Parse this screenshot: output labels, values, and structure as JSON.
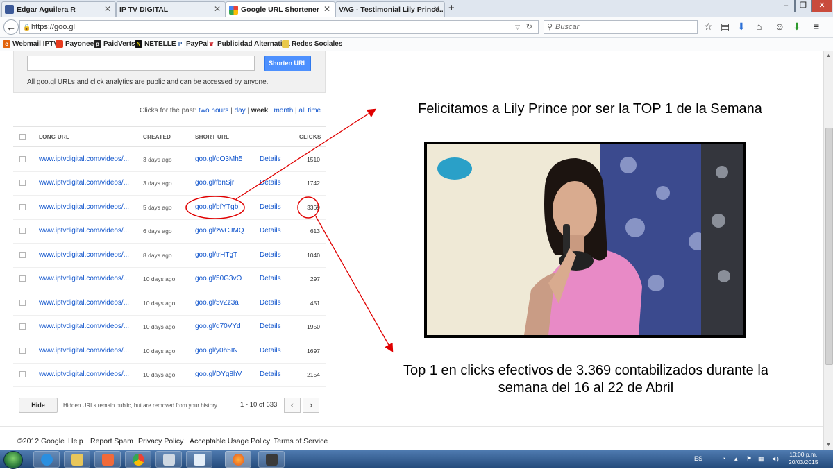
{
  "browser": {
    "tabs": [
      {
        "title": "Edgar Aguilera R"
      },
      {
        "title": "IP TV DIGITAL"
      },
      {
        "title": "Google URL Shortener"
      },
      {
        "title": "VAG - Testimonial Lily Prince..."
      }
    ],
    "url": "https://goo.gl",
    "search_placeholder": "Buscar"
  },
  "bookmarks": [
    "Webmail IPTV",
    "Payoneer",
    "PaidVerts",
    "NETELLER",
    "PayPal",
    "Publicidad Alternativa",
    "Redes Sociales"
  ],
  "shortener": {
    "button_label": "Shorten URL",
    "note": "All goo.gl URLs and click analytics are public and can be accessed by anyone."
  },
  "clicks_filter": {
    "prefix": "Clicks for the past:",
    "options": [
      "two hours",
      "day",
      "week",
      "month",
      "all time"
    ],
    "selected": "week"
  },
  "table": {
    "headers": [
      "LONG URL",
      "CREATED",
      "SHORT URL",
      "CLICKS"
    ],
    "rows": [
      {
        "long": "www.iptvdigital.com/videos/...",
        "created": "3 days ago",
        "short": "goo.gl/qO3Mh5",
        "details": "Details",
        "clicks": "1510"
      },
      {
        "long": "www.iptvdigital.com/videos/...",
        "created": "3 days ago",
        "short": "goo.gl/fbnSjr",
        "details": "Details",
        "clicks": "1742"
      },
      {
        "long": "www.iptvdigital.com/videos/...",
        "created": "5 days ago",
        "short": "goo.gl/bfYTgb",
        "details": "Details",
        "clicks": "3369"
      },
      {
        "long": "www.iptvdigital.com/videos/...",
        "created": "6 days ago",
        "short": "goo.gl/zwCJMQ",
        "details": "Details",
        "clicks": "613"
      },
      {
        "long": "www.iptvdigital.com/videos/...",
        "created": "8 days ago",
        "short": "goo.gl/trHTgT",
        "details": "Details",
        "clicks": "1040"
      },
      {
        "long": "www.iptvdigital.com/videos/...",
        "created": "10 days ago",
        "short": "goo.gl/50G3vO",
        "details": "Details",
        "clicks": "297"
      },
      {
        "long": "www.iptvdigital.com/videos/...",
        "created": "10 days ago",
        "short": "goo.gl/5vZz3a",
        "details": "Details",
        "clicks": "451"
      },
      {
        "long": "www.iptvdigital.com/videos/...",
        "created": "10 days ago",
        "short": "goo.gl/d70VYd",
        "details": "Details",
        "clicks": "1950"
      },
      {
        "long": "www.iptvdigital.com/videos/...",
        "created": "10 days ago",
        "short": "goo.gl/y0h5IN",
        "details": "Details",
        "clicks": "1697"
      },
      {
        "long": "www.iptvdigital.com/videos/...",
        "created": "10 days ago",
        "short": "goo.gl/DYg8hV",
        "details": "Details",
        "clicks": "2154"
      }
    ]
  },
  "table_footer": {
    "hide_label": "Hide",
    "hidden_note": "Hidden URLs remain public, but are removed from your history",
    "page_info": "1 - 10 of 633"
  },
  "footer": [
    "©2012 Google",
    "Help",
    "Report Spam",
    "Privacy Policy",
    "Acceptable Usage Policy",
    "Terms of Service"
  ],
  "annotation": {
    "headline": "Felicitamos a Lily Prince por ser la TOP 1 de la Semana",
    "caption": "Top 1 en clicks efectivos de 3.369 contabilizados durante la semana del 16 al 22 de Abril"
  },
  "taskbar": {
    "language": "ES",
    "time": "10:00 p.m.",
    "date": "20/03/2015"
  },
  "colors": {
    "link": "#1155cc",
    "button_blue": "#4d90fe",
    "annotation_red": "#e00000"
  }
}
